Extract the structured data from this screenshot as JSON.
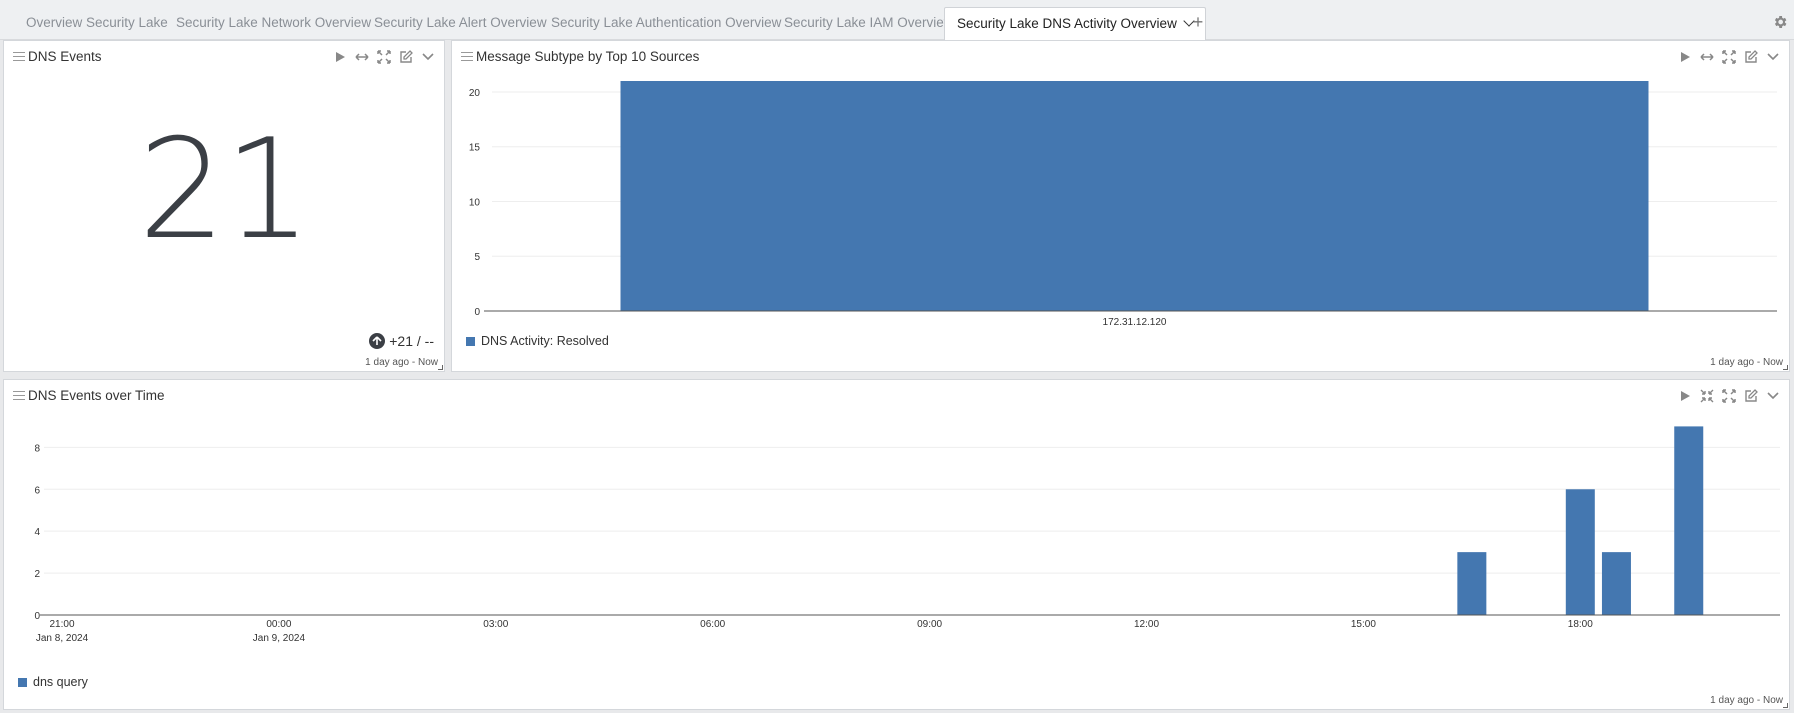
{
  "tabs": [
    {
      "label": "Overview Security Lake",
      "active": false
    },
    {
      "label": "Security Lake Network Overview",
      "active": false
    },
    {
      "label": "Security Lake Alert Overview",
      "active": false
    },
    {
      "label": "Security Lake Authentication Overview",
      "active": false
    },
    {
      "label": "Security Lake IAM Overview",
      "active": false
    },
    {
      "label": "Security Lake DNS Activity Overview",
      "active": true
    }
  ],
  "add_tab_label": "+",
  "colors": {
    "bar": "#4477b0",
    "accent_dark": "#3b3f45"
  },
  "panels": {
    "dns_events": {
      "title": "DNS Events",
      "value": "21",
      "trend_text": "+21 / --",
      "timerange": "1 day ago - Now"
    },
    "message_subtype": {
      "title": "Message Subtype by Top 10 Sources",
      "timerange": "1 day ago - Now",
      "legend": "DNS Activity: Resolved"
    },
    "dns_over_time": {
      "title": "DNS Events over Time",
      "timerange": "1 day ago - Now",
      "legend": "dns query"
    }
  },
  "chart_data": [
    {
      "type": "bar",
      "categories": [
        "172.31.12.120"
      ],
      "series": [
        {
          "name": "DNS Activity: Resolved",
          "values": [
            21
          ]
        }
      ],
      "ylim": [
        0,
        21
      ],
      "yticks": [
        0,
        5,
        10,
        15,
        20
      ],
      "grid": true,
      "legend": "bottom-left"
    },
    {
      "type": "bar",
      "x_ticks": [
        {
          "time": "21:00",
          "date": "Jan 8, 2024"
        },
        {
          "time": "00:00",
          "date": "Jan 9, 2024"
        },
        {
          "time": "03:00",
          "date": ""
        },
        {
          "time": "06:00",
          "date": ""
        },
        {
          "time": "09:00",
          "date": ""
        },
        {
          "time": "12:00",
          "date": ""
        },
        {
          "time": "15:00",
          "date": ""
        },
        {
          "time": "18:00",
          "date": ""
        }
      ],
      "x_range": [
        "2024-01-08 21:00",
        "2024-01-09 23:30"
      ],
      "series": [
        {
          "name": "dns query",
          "points": [
            {
              "x": "2024-01-09 16:30",
              "y": 3
            },
            {
              "x": "2024-01-09 18:00",
              "y": 6
            },
            {
              "x": "2024-01-09 18:30",
              "y": 3
            },
            {
              "x": "2024-01-09 19:30",
              "y": 9
            }
          ]
        }
      ],
      "ylim": [
        0,
        9
      ],
      "yticks": [
        0,
        2,
        4,
        6,
        8
      ],
      "grid": true,
      "legend": "bottom-left"
    }
  ]
}
